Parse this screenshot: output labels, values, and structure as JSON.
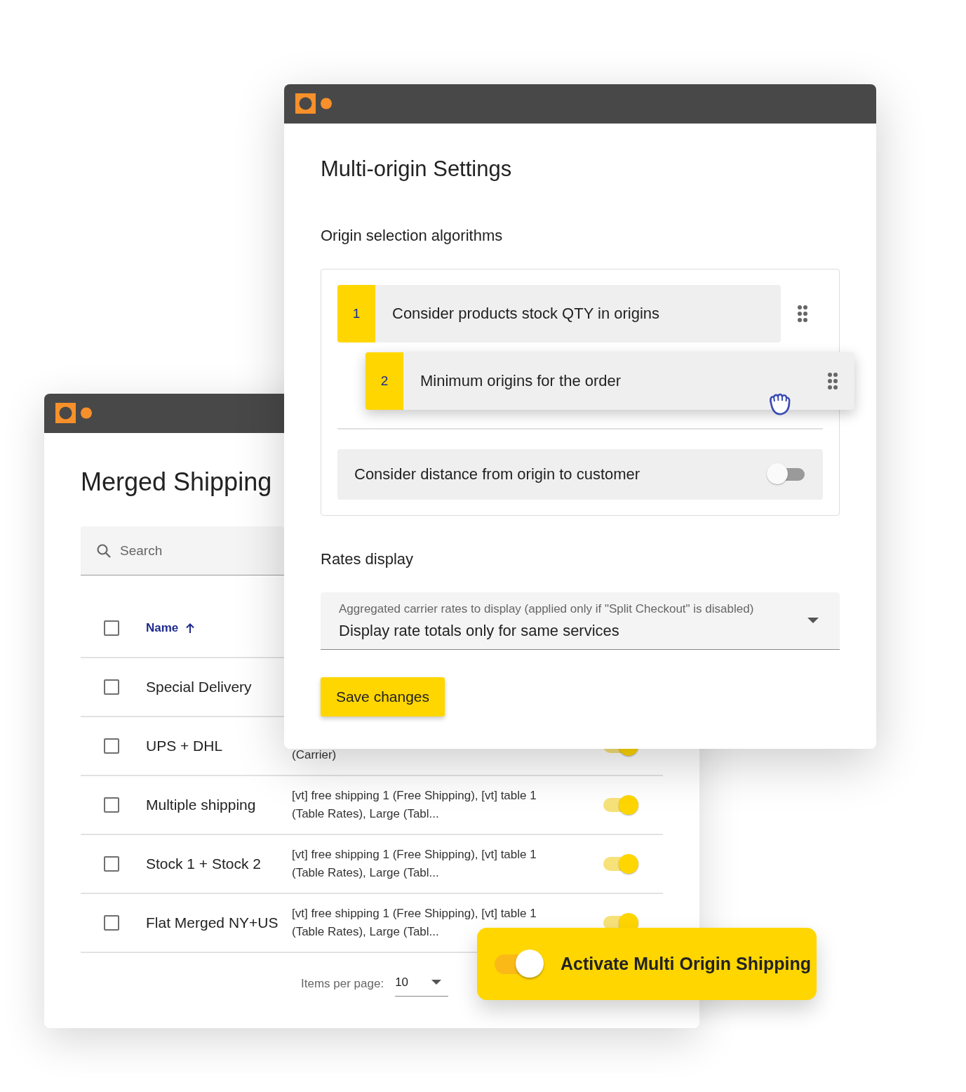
{
  "back_window": {
    "title": "Merged Shipping",
    "search": {
      "placeholder": "Search"
    },
    "table": {
      "select_all": {
        "checked": false
      },
      "columns": [
        {
          "label": "Name",
          "sorted_ascending": true
        }
      ],
      "rows": [
        {
          "name": "Special Delivery",
          "checked": false
        },
        {
          "name": "UPS + DHL",
          "checked": false,
          "carriers": "(Carrier)",
          "on": true
        },
        {
          "name": "Multiple shipping",
          "checked": false,
          "carriers": "[vt] free shipping 1 (Free Shipping), [vt] table 1 (Table Rates), Large (Tabl...",
          "on": true
        },
        {
          "name": "Stock 1 + Stock 2",
          "checked": false,
          "carriers": "[vt] free shipping 1 (Free Shipping), [vt] table 1 (Table Rates), Large (Tabl...",
          "on": true
        },
        {
          "name": "Flat Merged NY+US",
          "checked": false,
          "carriers": "[vt] free shipping 1 (Free Shipping), [vt] table 1 (Table Rates), Large (Tabl...",
          "on": true
        }
      ]
    },
    "footer": {
      "items_per_page_label": "Items per page:",
      "items_per_page": "10"
    }
  },
  "front_window": {
    "title": "Multi-origin Settings",
    "origin_section": {
      "heading": "Origin selection algorithms",
      "algorithms": [
        {
          "number": "1",
          "label": "Consider products stock QTY in origins",
          "dragging": false
        },
        {
          "number": "2",
          "label": "Minimum origins for the order",
          "dragging": true
        }
      ],
      "distance_option": {
        "label": "Consider distance from origin to customer",
        "on": false
      }
    },
    "rates_section": {
      "heading": "Rates display",
      "select": {
        "label": "Aggregated carrier rates to display (applied only if \"Split Checkout\" is disabled)",
        "value": "Display rate totals only for same services"
      }
    },
    "save_button": "Save changes"
  },
  "activate_banner": {
    "label": "Activate Multi Origin Shipping",
    "on": true
  }
}
